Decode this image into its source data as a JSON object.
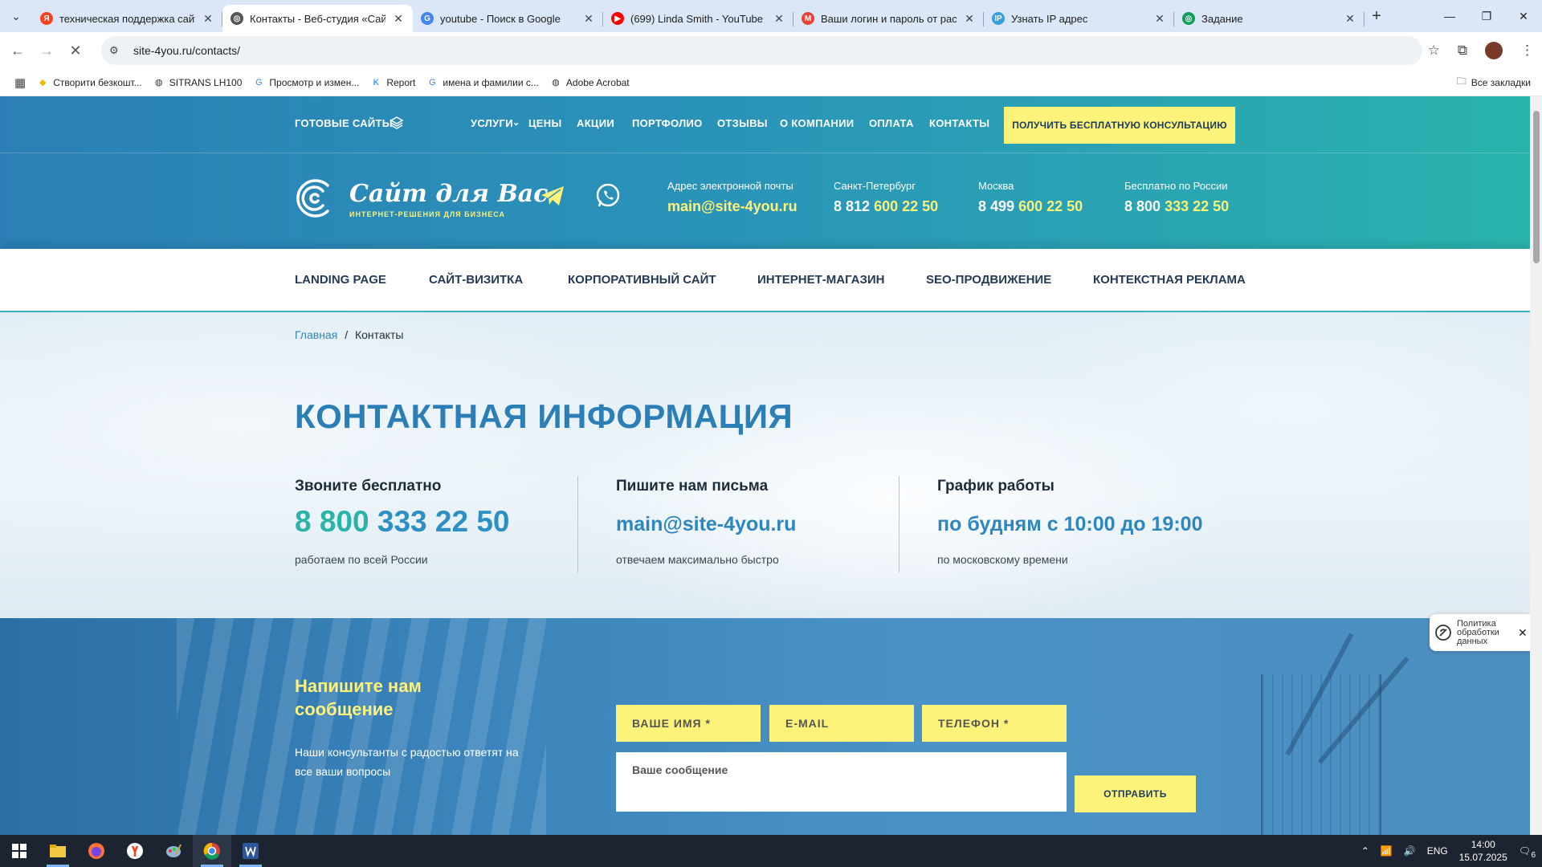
{
  "browser": {
    "tabs": [
      {
        "title": "техническая поддержка сайта",
        "favicon": "yandex-icon",
        "color": "#fc3f1d",
        "glyph": "Я"
      },
      {
        "title": "Контакты - Веб-студия «Сайт для Вас»",
        "favicon": "site-icon",
        "color": "#555555",
        "glyph": "◎",
        "active": true
      },
      {
        "title": "youtube - Поиск в Google",
        "favicon": "google-icon",
        "color": "#4285f4",
        "glyph": "G"
      },
      {
        "title": "(699) Linda Smith - YouTube",
        "favicon": "youtube-icon",
        "color": "#ff0000",
        "glyph": "▶"
      },
      {
        "title": "Ваши логин и пароль от расширения",
        "favicon": "gmail-icon",
        "color": "#ea4335",
        "glyph": "M"
      },
      {
        "title": "Узнать IP адрес",
        "favicon": "ip-icon",
        "color": "#35a0dc",
        "glyph": "IP"
      },
      {
        "title": "Задание",
        "favicon": "task-icon",
        "color": "#0f9d58",
        "glyph": "◎"
      }
    ],
    "url": "site-4you.ru/contacts/",
    "bookmarks": [
      {
        "label": "Створити безкошт...",
        "icon": "diamond-icon",
        "glyph": "◆",
        "color": "#f2b705"
      },
      {
        "label": "SITRANS LH100",
        "icon": "globe-icon",
        "glyph": "◍",
        "color": "#333333"
      },
      {
        "label": "Просмотр и измен...",
        "icon": "google-icon",
        "glyph": "G",
        "color": "#4285f4"
      },
      {
        "label": "Report",
        "icon": "vk-icon",
        "glyph": "K",
        "color": "#0077ff"
      },
      {
        "label": "имена и фамилии с...",
        "icon": "google-icon",
        "glyph": "G",
        "color": "#4285f4"
      },
      {
        "label": "Adobe Acrobat",
        "icon": "globe-icon",
        "glyph": "◍",
        "color": "#333333"
      }
    ],
    "all_bookmarks": "Все закладки"
  },
  "site": {
    "colors": {
      "accent": "#2b7fb6",
      "yellow": "#fdf27a",
      "teal": "#2ab4a9"
    },
    "topnav": {
      "ready_sites": "ГОТОВЫЕ САЙТЫ",
      "services": "УСЛУГИ",
      "prices": "ЦЕНЫ",
      "promos": "АКЦИИ",
      "portfolio": "ПОРТФОЛИО",
      "reviews": "ОТЗЫВЫ",
      "about": "О КОМПАНИИ",
      "payment": "ОПЛАТА",
      "contacts": "КОНТАКТЫ",
      "cta": "ПОЛУЧИТЬ БЕСПЛАТНУЮ КОНСУЛЬТАЦИЮ"
    },
    "logo": {
      "name": "Сайт для Вас",
      "tagline": "ИНТЕРНЕТ-РЕШЕНИЯ ДЛЯ БИЗНЕСА"
    },
    "header_contacts": {
      "email_label": "Адрес электронной почты",
      "email": "main@site-4you.ru",
      "spb_label": "Санкт-Петербург",
      "spb_prefix": "8 812",
      "spb_number": "600 22 50",
      "msk_label": "Москва",
      "msk_prefix": "8 499",
      "msk_number": "600 22 50",
      "ru_label": "Бесплатно по России",
      "ru_prefix": "8 800",
      "ru_number": "333 22 50"
    },
    "secnav": [
      "LANDING PAGE",
      "САЙТ-ВИЗИТКА",
      "КОРПОРАТИВНЫЙ САЙТ",
      "ИНТЕРНЕТ-МАГАЗИН",
      "SEO-ПРОДВИЖЕНИЕ",
      "КОНТЕКСТНАЯ РЕКЛАМА"
    ],
    "breadcrumb": {
      "home": "Главная",
      "sep": "/",
      "current": "Контакты"
    },
    "heading": "КОНТАКТНАЯ ИНФОРМАЦИЯ",
    "info": {
      "call_title": "Звоните бесплатно",
      "call_prefix": "8 800",
      "call_number": "333 22 50",
      "call_note": "работаем по всей России",
      "mail_title": "Пишите нам письма",
      "mail_value": "main@site-4you.ru",
      "mail_note": "отвечаем максимально быстро",
      "hours_title": "График работы",
      "hours_value": "по будням с 10:00 до 19:00",
      "hours_note": "по московскому времени"
    },
    "form": {
      "title": "Напишите нам сообщение",
      "text": "Наши консультанты с радостью ответят на все ваши вопросы",
      "name_placeholder": "ВАШЕ ИМЯ *",
      "email_placeholder": "E-MAIL",
      "phone_placeholder": "ТЕЛЕФОН *",
      "message_placeholder": "Ваше сообщение",
      "submit": "ОТПРАВИТЬ"
    },
    "policy": "Политика обработки данных"
  },
  "taskbar": {
    "lang": "ENG",
    "time": "14:00",
    "date": "15.07.2025",
    "notifications": "6"
  }
}
